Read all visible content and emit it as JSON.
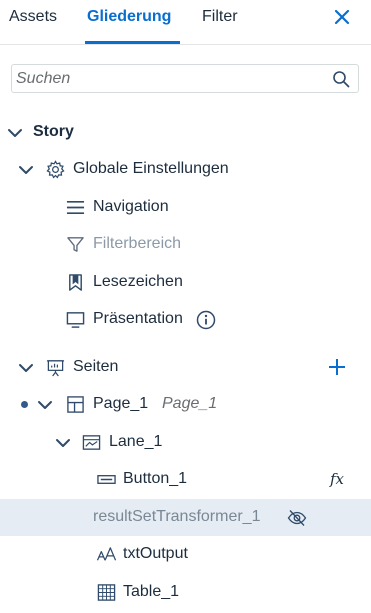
{
  "tabs": [
    {
      "label": "Assets",
      "active": false
    },
    {
      "label": "Gliederung",
      "active": true
    },
    {
      "label": "Filter",
      "active": false
    }
  ],
  "search": {
    "placeholder": "Suchen",
    "value": ""
  },
  "tree": {
    "story": {
      "label": "Story"
    },
    "global_settings": {
      "label": "Globale Einstellungen"
    },
    "navigation": {
      "label": "Navigation"
    },
    "filter_area": {
      "label": "Filterbereich"
    },
    "bookmarks": {
      "label": "Lesezeichen"
    },
    "presentation": {
      "label": "Präsentation"
    },
    "pages": {
      "label": "Seiten"
    },
    "page1": {
      "label": "Page_1",
      "subtitle": "Page_1"
    },
    "lane1": {
      "label": "Lane_1"
    },
    "button1": {
      "label": "Button_1",
      "badge": "fx"
    },
    "result_set": {
      "label": "resultSetTransformer_1"
    },
    "txt_output": {
      "label": "txtOutput"
    },
    "table1": {
      "label": "Table_1"
    }
  },
  "colors": {
    "accent": "#0a6ed1",
    "selected_bg": "#e5ecf3",
    "text": "#1d2d3e"
  }
}
